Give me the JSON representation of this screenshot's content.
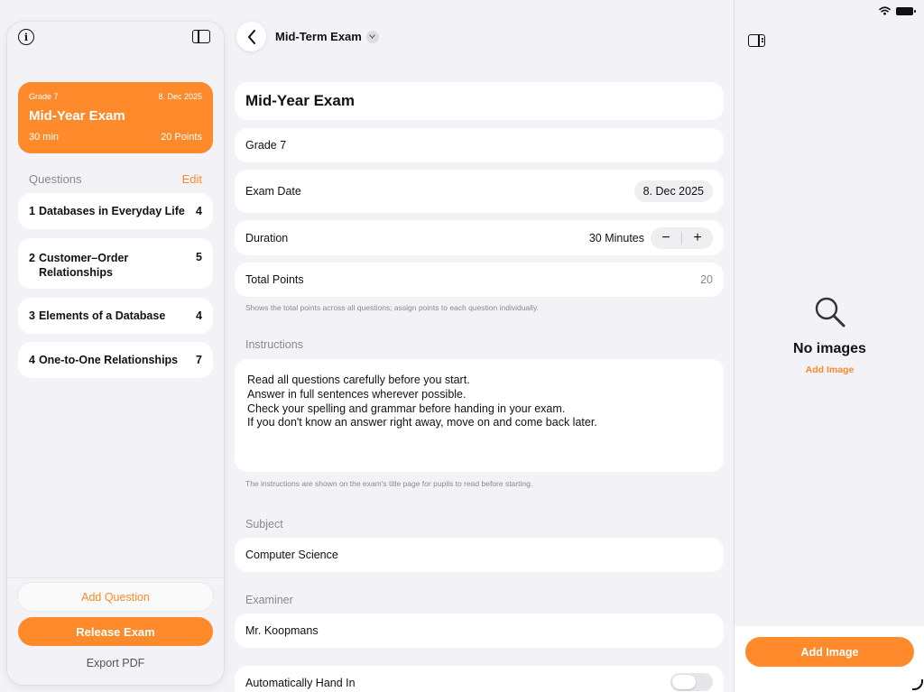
{
  "sidebar": {
    "exam_card": {
      "grade": "Grade 7",
      "date": "8. Dec 2025",
      "title": "Mid-Year Exam",
      "duration": "30 min",
      "points": "20 Points"
    },
    "questions_header": "Questions",
    "edit_label": "Edit",
    "questions": [
      {
        "number": "1",
        "title": "Databases in Everyday Life",
        "points": "4"
      },
      {
        "number": "2",
        "title": "Customer–Order Relationships",
        "points": "5"
      },
      {
        "number": "3",
        "title": "Elements of a Database",
        "points": "4"
      },
      {
        "number": "4",
        "title": "One-to-One Relationships",
        "points": "7"
      }
    ],
    "add_question": "Add Question",
    "release_exam": "Release Exam",
    "export_pdf": "Export PDF"
  },
  "header": {
    "title": "Mid-Term Exam"
  },
  "form": {
    "title": "Mid-Year Exam",
    "grade": "Grade 7",
    "exam_date_label": "Exam Date",
    "exam_date_value": "8. Dec 2025",
    "duration_label": "Duration",
    "duration_value": "30 Minutes",
    "stepper_minus": "−",
    "stepper_plus": "+",
    "total_points_label": "Total Points",
    "total_points_value": "20",
    "total_points_hint": "Shows the total points across all questions; assign points to each question individually.",
    "instructions_label": "Instructions",
    "instructions_lines": [
      "Read all questions carefully before you start.",
      "Answer in full sentences wherever possible.",
      "Check your spelling and grammar before handing in your exam.",
      "If you don't know an answer right away, move on and come back later."
    ],
    "instructions_hint": "The instructions are shown on the exam's title page for pupils to read before starting.",
    "subject_label": "Subject",
    "subject_value": "Computer Science",
    "examiner_label": "Examiner",
    "examiner_value": "Mr. Koopmans",
    "auto_hand_in_label": "Automatically Hand In",
    "auto_hand_in_on": false
  },
  "right_panel": {
    "empty_title": "No images",
    "add_image_link": "Add Image",
    "add_image_button": "Add Image"
  },
  "colors": {
    "accent": "#ff8a2c",
    "background": "#f2f2f7",
    "card": "#ffffff"
  }
}
